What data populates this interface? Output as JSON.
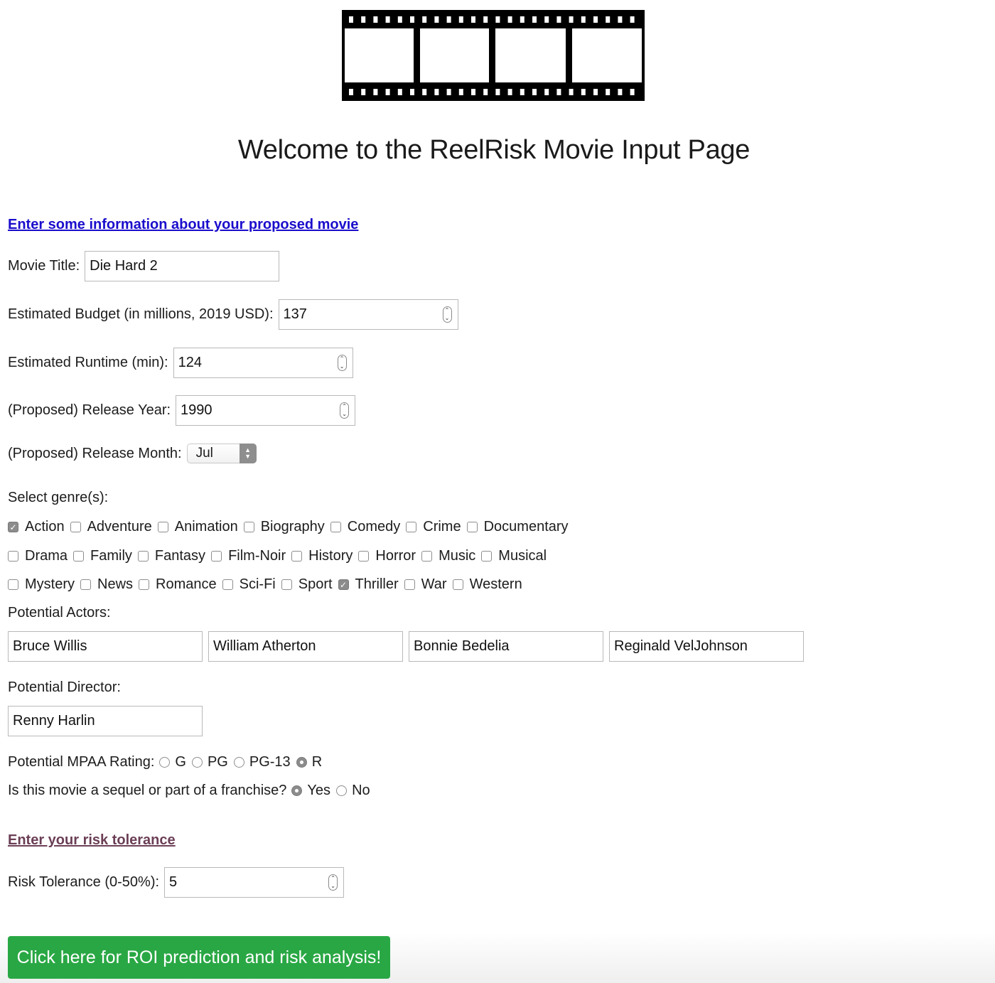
{
  "header": {
    "logo_icon": "film-strip-icon",
    "title": "Welcome to the ReelRisk Movie Input Page"
  },
  "movie_section": {
    "link_text": "Enter some information about your proposed movie",
    "title_label": "Movie Title:",
    "title_value": "Die Hard 2",
    "budget_label": "Estimated Budget (in millions, 2019 USD):",
    "budget_value": "137",
    "runtime_label": "Estimated Runtime (min):",
    "runtime_value": "124",
    "year_label": "(Proposed) Release Year:",
    "year_value": "1990",
    "month_label": "(Proposed) Release Month:",
    "month_value": "Jul",
    "genre_label": "Select genre(s):",
    "genres": [
      [
        {
          "label": "Action",
          "checked": true
        },
        {
          "label": "Adventure",
          "checked": false
        },
        {
          "label": "Animation",
          "checked": false
        },
        {
          "label": "Biography",
          "checked": false
        },
        {
          "label": "Comedy",
          "checked": false
        },
        {
          "label": "Crime",
          "checked": false
        },
        {
          "label": "Documentary",
          "checked": false
        }
      ],
      [
        {
          "label": "Drama",
          "checked": false
        },
        {
          "label": "Family",
          "checked": false
        },
        {
          "label": "Fantasy",
          "checked": false
        },
        {
          "label": "Film-Noir",
          "checked": false
        },
        {
          "label": "History",
          "checked": false
        },
        {
          "label": "Horror",
          "checked": false
        },
        {
          "label": "Music",
          "checked": false
        },
        {
          "label": "Musical",
          "checked": false
        }
      ],
      [
        {
          "label": "Mystery",
          "checked": false
        },
        {
          "label": "News",
          "checked": false
        },
        {
          "label": "Romance",
          "checked": false
        },
        {
          "label": "Sci-Fi",
          "checked": false
        },
        {
          "label": "Sport",
          "checked": false
        },
        {
          "label": "Thriller",
          "checked": true
        },
        {
          "label": "War",
          "checked": false
        },
        {
          "label": "Western",
          "checked": false
        }
      ]
    ],
    "actors_label": "Potential Actors:",
    "actors": [
      "Bruce Willis",
      "William Atherton",
      "Bonnie Bedelia",
      "Reginald VelJohnson"
    ],
    "director_label": "Potential Director:",
    "director_value": "Renny Harlin",
    "rating_label": "Potential MPAA Rating:",
    "ratings": [
      {
        "label": "G",
        "checked": false
      },
      {
        "label": "PG",
        "checked": false
      },
      {
        "label": "PG-13",
        "checked": false
      },
      {
        "label": "R",
        "checked": true
      }
    ],
    "sequel_label": "Is this movie a sequel or part of a franchise?",
    "sequel_options": [
      {
        "label": "Yes",
        "checked": true
      },
      {
        "label": "No",
        "checked": false
      }
    ]
  },
  "risk_section": {
    "link_text": "Enter your risk tolerance",
    "tolerance_label": "Risk Tolerance (0-50%):",
    "tolerance_value": "5"
  },
  "submit": {
    "label": "Click here for ROI prediction and risk analysis!",
    "color": "#29a744"
  }
}
